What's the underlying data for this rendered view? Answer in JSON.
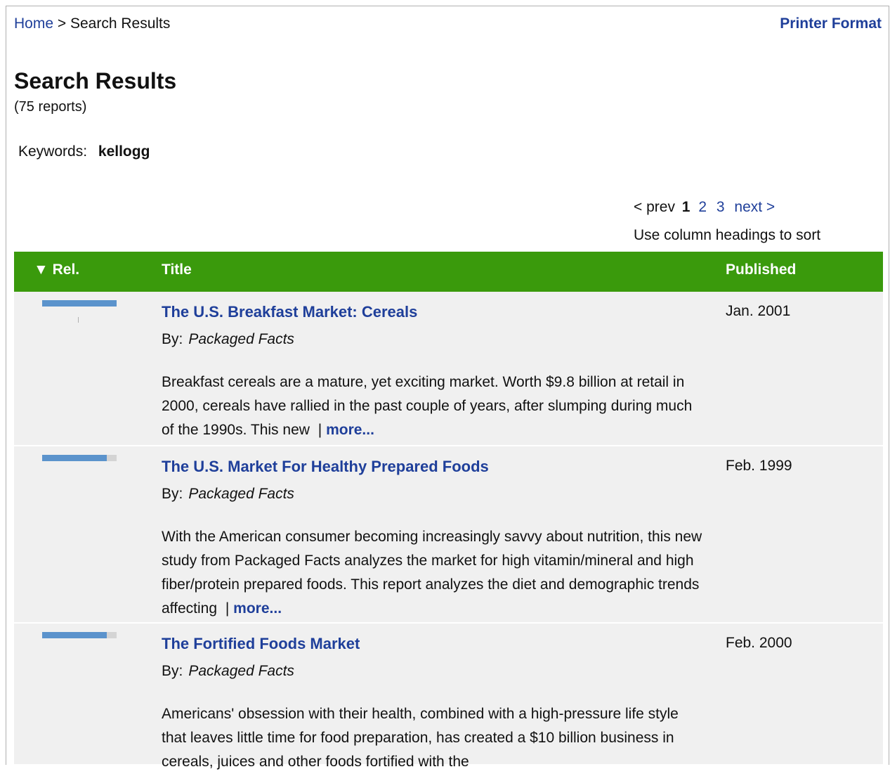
{
  "breadcrumb": {
    "home": "Home",
    "separator": ">",
    "current": "Search Results"
  },
  "printer_format": "Printer Format",
  "page_title": "Search Results",
  "report_count": "(75 reports)",
  "keywords": {
    "label": "Keywords:",
    "value": "kellogg"
  },
  "pager": {
    "prev": "< prev",
    "current": "1",
    "pages": [
      "2",
      "3"
    ],
    "next": "next >"
  },
  "sort_note": "Use column headings to sort",
  "table": {
    "header_color": "#3a9a0c",
    "columns": {
      "rel": "▼ Rel.",
      "title": "Title",
      "published": "Published"
    },
    "rows": [
      {
        "relevance": 1.0,
        "title": "The U.S. Breakfast Market: Cereals",
        "by_label": "By:",
        "publisher": "Packaged Facts",
        "description": "Breakfast cereals are a mature, yet exciting market. Worth $9.8 billion at retail in 2000, cereals have rallied in the past couple of years, after slumping during much of the 1990s. This new",
        "more": "more...",
        "published": "Jan. 2001"
      },
      {
        "relevance": 0.87,
        "title": "The U.S. Market For Healthy Prepared Foods",
        "by_label": "By:",
        "publisher": "Packaged Facts",
        "description": "With the American consumer becoming increasingly savvy about nutrition, this new study from Packaged Facts analyzes the market for high vitamin/mineral and high fiber/protein prepared foods. This report analyzes the diet and demographic trends affecting",
        "more": "more...",
        "published": "Feb. 1999"
      },
      {
        "relevance": 0.87,
        "title": "The Fortified Foods Market",
        "by_label": "By:",
        "publisher": "Packaged Facts",
        "description": "Americans' obsession with their health, combined with a high-pressure life style that leaves little time for food preparation, has created a $10 billion business in cereals, juices and other foods fortified with the",
        "more": "",
        "published": "Feb. 2000"
      }
    ]
  }
}
